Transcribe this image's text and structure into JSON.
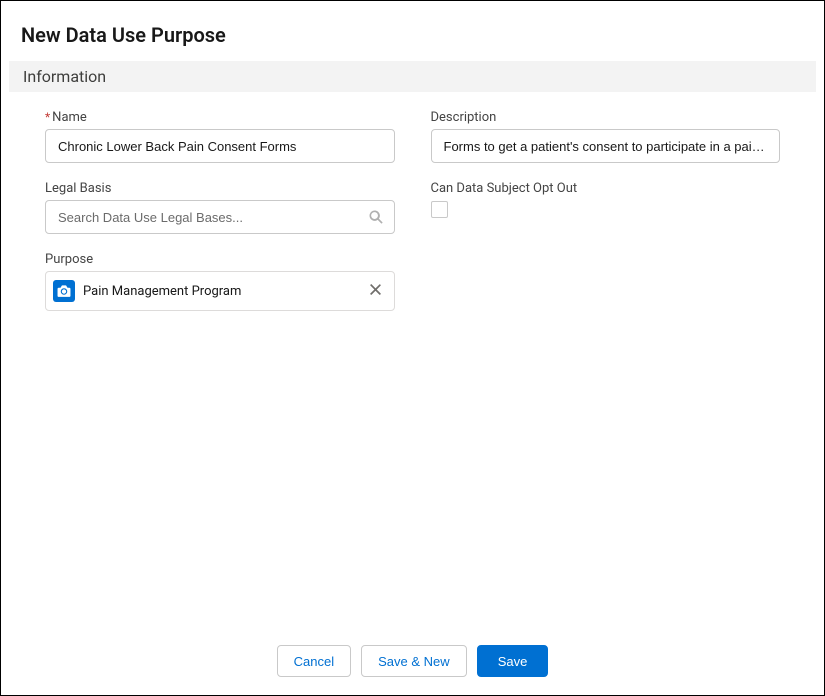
{
  "header": {
    "title": "New Data Use Purpose"
  },
  "section": {
    "title": "Information"
  },
  "fields": {
    "name": {
      "label": "Name",
      "required_mark": "*",
      "value": "Chronic Lower Back Pain Consent Forms"
    },
    "description": {
      "label": "Description",
      "value": "Forms to get a patient's consent to participate in a pain management program."
    },
    "legal_basis": {
      "label": "Legal Basis",
      "placeholder": "Search Data Use Legal Bases..."
    },
    "can_opt_out": {
      "label": "Can Data Subject Opt Out",
      "checked": false
    },
    "purpose": {
      "label": "Purpose",
      "selected": "Pain Management Program"
    }
  },
  "footer": {
    "cancel": "Cancel",
    "save_new": "Save & New",
    "save": "Save"
  }
}
